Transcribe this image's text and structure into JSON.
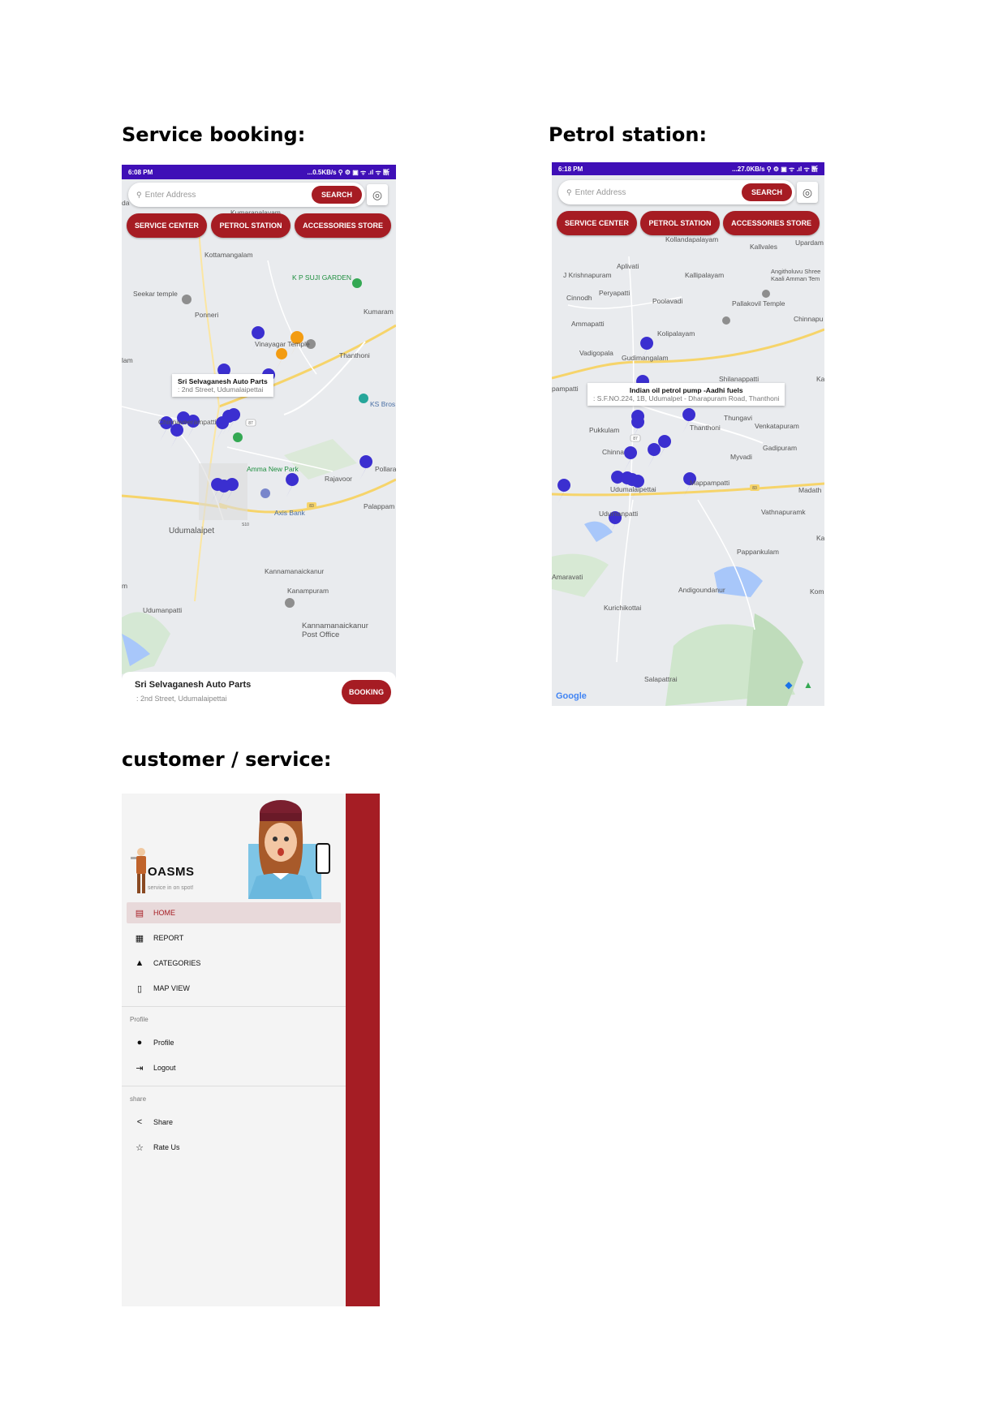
{
  "headings": {
    "service_booking": "Service booking:",
    "petrol_station": "Petrol station:",
    "customer_service": "customer / service:"
  },
  "screen1": {
    "status": {
      "time": "6:08 PM",
      "right": "...0.5KB/s ⚲ ⚙ ▣ ᯤ .ıl ᯤ 㫁"
    },
    "search": {
      "placeholder": "Enter Address",
      "button": "SEARCH"
    },
    "categories": [
      "SERVICE CENTER",
      "PETROL STATION",
      "ACCESSORIES STORE"
    ],
    "map_labels": [
      "Kumarapalayam",
      "Kottamangalam",
      "K P SUJI GARDEN",
      "Seekar temple",
      "Ponneri",
      "Kumaram",
      "Vinayagar Temple",
      "Thanthoni",
      "Chinnaveerampatti",
      "KS Bros",
      "Amma New Park",
      "Rajavoor",
      "Pollara",
      "Axis Bank",
      "Palappam",
      "Udumalaipet",
      "Kannamanaickanur",
      "Kanampuram",
      "Udumanpatti",
      "Kannamanaickanur Post Office",
      "lam",
      "m",
      "da"
    ],
    "info_window": {
      "title": "Sri Selvaganesh Auto Parts",
      "subtitle": ": 2nd Street, Udumalaipettai"
    },
    "bottom_card": {
      "name": "Sri Selvaganesh Auto Parts",
      "address": ": 2nd Street, Udumalaipettai",
      "button": "BOOKING"
    },
    "road_shields": [
      "87",
      "83",
      "S10"
    ]
  },
  "screen2": {
    "status": {
      "time": "6:18 PM",
      "right": "...27.0KB/s ⚲ ⚙ ▣ ᯤ .ıl ᯤ 㫁"
    },
    "search": {
      "placeholder": "Enter Address",
      "button": "SEARCH"
    },
    "categories": [
      "SERVICE CENTER",
      "PETROL STATION",
      "ACCESSORIES STORE"
    ],
    "map_labels": [
      "Kollandapalayam",
      "Kallvales",
      "Upardam",
      "Aplivati",
      "J Krishnapuram",
      "Kallipalayam",
      "Angitholuvu Shree Kaali Amman Tem",
      "Peryapatti",
      "Cinnodh",
      "Poolavadi",
      "Pallakovil Temple",
      "Chinnapu",
      "Ammapatti",
      "Kolipalayam",
      "Vadigopala",
      "Gudimangalam",
      "Shilanappatti",
      "Ka",
      "pampatti",
      "Thungavi",
      "Venkatapuram",
      "Pukkulam",
      "Chinna",
      "Thanthoni",
      "Gadipuram",
      "Myvadi",
      "Mappampatti",
      "Udumalaipettai",
      "Madath",
      "Vathnapuramk",
      "Udumanpatti",
      "Kai",
      "Pappankulam",
      "Amaravati",
      "Andigoundanur",
      "Komi",
      "Kurichikottai",
      "Salapattrai"
    ],
    "info_window": {
      "title": "Indian oil petrol pump -Aadhi fuels",
      "subtitle": ": S.F.NO.224, 1B, Udumalpet - Dharapuram Road, Thanthoni"
    },
    "google": "Google",
    "road_shields": [
      "87",
      "83"
    ]
  },
  "drawer": {
    "brand": "OASMS",
    "tagline": "service in on spot!",
    "menu": [
      {
        "label": "HOME",
        "icon": "home-icon",
        "active": true
      },
      {
        "label": "REPORT",
        "icon": "report-icon",
        "active": false
      },
      {
        "label": "CATEGORIES",
        "icon": "categories-icon",
        "active": false
      },
      {
        "label": "MAP VIEW",
        "icon": "map-icon",
        "active": false
      }
    ],
    "profile_section": {
      "label": "Profile",
      "items": [
        {
          "label": "Profile",
          "icon": "person-icon"
        },
        {
          "label": "Logout",
          "icon": "logout-icon"
        }
      ]
    },
    "share_section": {
      "label": "share",
      "items": [
        {
          "label": "Share",
          "icon": "share-icon"
        },
        {
          "label": "Rate Us",
          "icon": "star-icon"
        }
      ]
    }
  },
  "colors": {
    "accent": "#a61c23",
    "statusbar": "#3f0fb7",
    "pin": "#3b2fd0",
    "drawer_bg": "#a51d24"
  }
}
